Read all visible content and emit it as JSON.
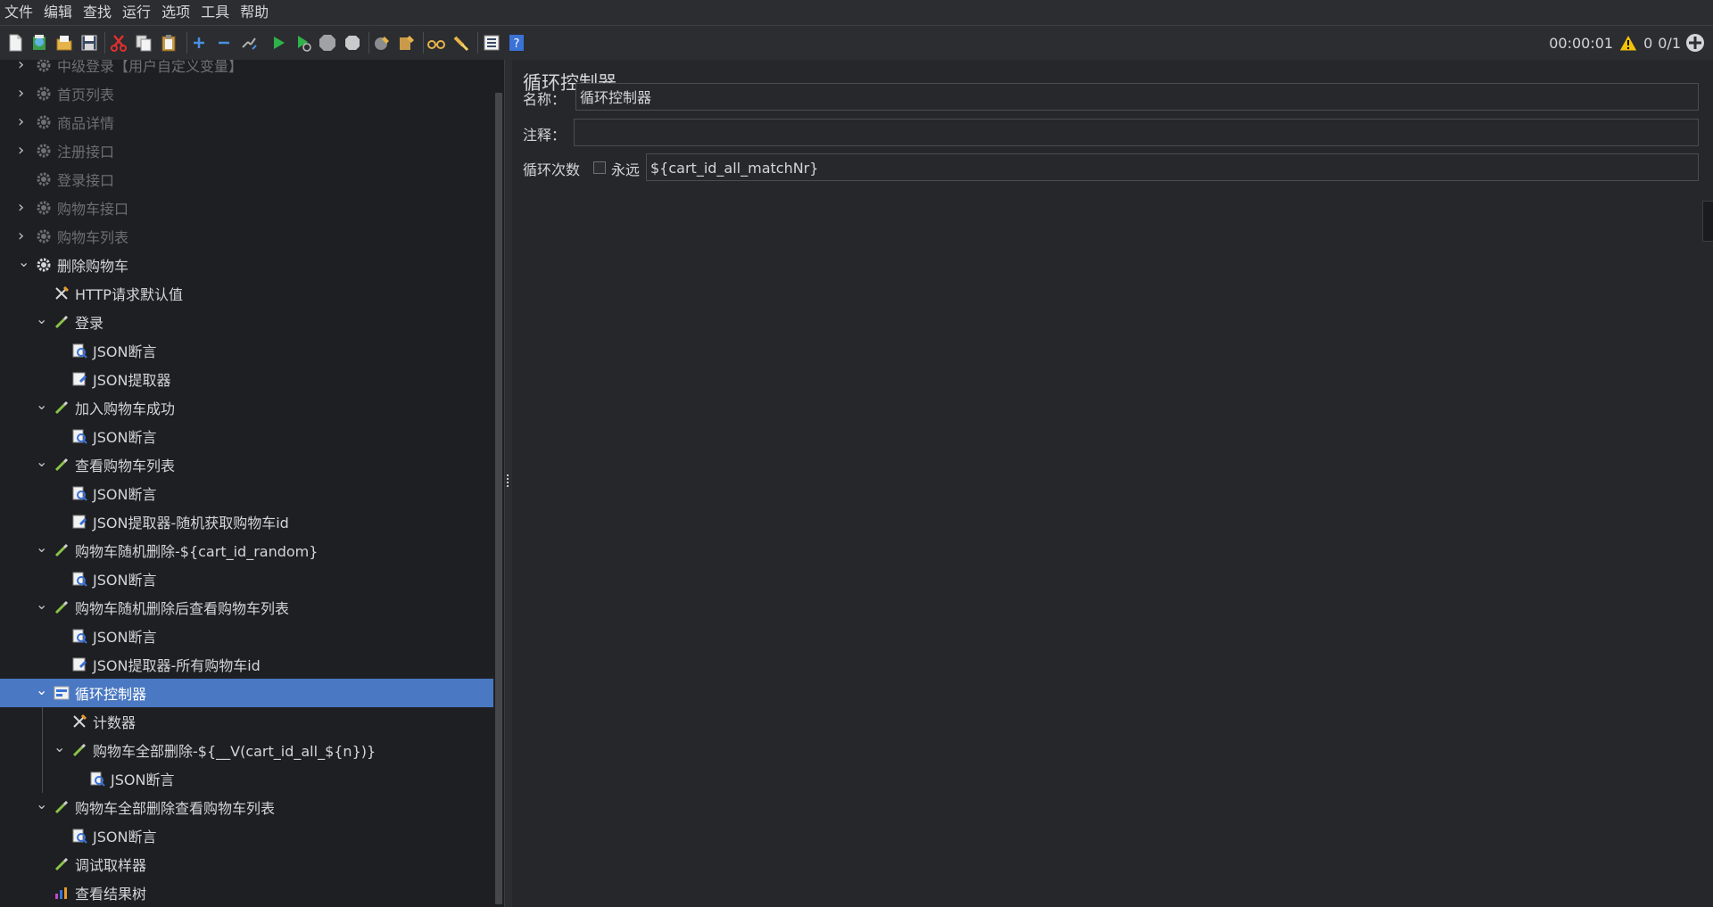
{
  "menubar": {
    "items": [
      "文件",
      "编辑",
      "查找",
      "运行",
      "选项",
      "工具",
      "帮助"
    ]
  },
  "toolbar": {
    "icons": [
      "new-icon",
      "templates-icon",
      "open-icon",
      "save-icon",
      "cut-icon",
      "copy-icon",
      "paste-icon",
      "expand-icon",
      "collapse-icon",
      "toggle-icon",
      "start-icon",
      "start-no-pauses-icon",
      "stop-icon",
      "shutdown-icon",
      "clear-icon",
      "clear-all-icon",
      "search-icon",
      "reset-search-icon",
      "function-helper-icon",
      "help-icon"
    ],
    "timer": "00:00:01",
    "warning_count": "0",
    "threads": "0/1"
  },
  "tree": {
    "items": [
      {
        "label": "中级登录【用户自定义变量】",
        "icon": "gear-icon",
        "state": "collapsed",
        "disabled": true
      },
      {
        "label": "首页列表",
        "icon": "gear-icon",
        "state": "collapsed",
        "disabled": true
      },
      {
        "label": "商品详情",
        "icon": "gear-icon",
        "state": "collapsed",
        "disabled": true
      },
      {
        "label": "注册接口",
        "icon": "gear-icon",
        "state": "collapsed",
        "disabled": true
      },
      {
        "label": "登录接口",
        "icon": "gear-icon",
        "state": "leaf",
        "disabled": true
      },
      {
        "label": "购物车接口",
        "icon": "gear-icon",
        "state": "collapsed",
        "disabled": true
      },
      {
        "label": "购物车列表",
        "icon": "gear-icon",
        "state": "collapsed",
        "disabled": true
      },
      {
        "label": "删除购物车",
        "icon": "gear-icon",
        "state": "expanded",
        "disabled": false
      },
      {
        "label": "HTTP请求默认值",
        "icon": "tools-icon",
        "state": "leaf",
        "disabled": false
      },
      {
        "label": "登录",
        "icon": "pipette-icon",
        "state": "expanded",
        "disabled": false
      },
      {
        "label": "JSON断言",
        "icon": "assertion-icon",
        "state": "leaf",
        "disabled": false
      },
      {
        "label": "JSON提取器",
        "icon": "extractor-icon",
        "state": "leaf",
        "disabled": false
      },
      {
        "label": "加入购物车成功",
        "icon": "pipette-icon",
        "state": "expanded",
        "disabled": false
      },
      {
        "label": "JSON断言",
        "icon": "assertion-icon",
        "state": "leaf",
        "disabled": false
      },
      {
        "label": "查看购物车列表",
        "icon": "pipette-icon",
        "state": "expanded",
        "disabled": false
      },
      {
        "label": "JSON断言",
        "icon": "assertion-icon",
        "state": "leaf",
        "disabled": false
      },
      {
        "label": "JSON提取器-随机获取购物车id",
        "icon": "extractor-icon",
        "state": "leaf",
        "disabled": false
      },
      {
        "label": "购物车随机删除-${cart_id_random}",
        "icon": "pipette-icon",
        "state": "expanded",
        "disabled": false
      },
      {
        "label": "JSON断言",
        "icon": "assertion-icon",
        "state": "leaf",
        "disabled": false
      },
      {
        "label": "购物车随机删除后查看购物车列表",
        "icon": "pipette-icon",
        "state": "expanded",
        "disabled": false
      },
      {
        "label": "JSON断言",
        "icon": "assertion-icon",
        "state": "leaf",
        "disabled": false
      },
      {
        "label": "JSON提取器-所有购物车id",
        "icon": "extractor-icon",
        "state": "leaf",
        "disabled": false
      },
      {
        "label": "循环控制器",
        "icon": "loop-controller-icon",
        "state": "expanded",
        "disabled": false,
        "selected": true
      },
      {
        "label": "计数器",
        "icon": "tools-icon",
        "state": "leaf",
        "disabled": false
      },
      {
        "label": "购物车全部删除-${__V(cart_id_all_${n})}",
        "icon": "pipette-icon",
        "state": "expanded",
        "disabled": false
      },
      {
        "label": "JSON断言",
        "icon": "assertion-icon",
        "state": "leaf",
        "disabled": false
      },
      {
        "label": "购物车全部删除查看购物车列表",
        "icon": "pipette-icon",
        "state": "expanded",
        "disabled": false
      },
      {
        "label": "JSON断言",
        "icon": "assertion-icon",
        "state": "leaf",
        "disabled": false
      },
      {
        "label": "调试取样器",
        "icon": "pipette-icon",
        "state": "leaf",
        "disabled": false
      },
      {
        "label": "查看结果树",
        "icon": "chart-icon",
        "state": "leaf",
        "disabled": false
      }
    ]
  },
  "panel": {
    "title": "循环控制器",
    "name_label": "名称：",
    "name_value": "循环控制器",
    "comment_label": "注释：",
    "comment_value": "",
    "loop_label": "循环次数",
    "forever_label": "永远",
    "forever_checked": false,
    "loop_value": "${cart_id_all_matchNr}"
  },
  "colors": {
    "selection": "#4a78c2",
    "background": "#1e1f22",
    "text": "#d3d5d8"
  }
}
